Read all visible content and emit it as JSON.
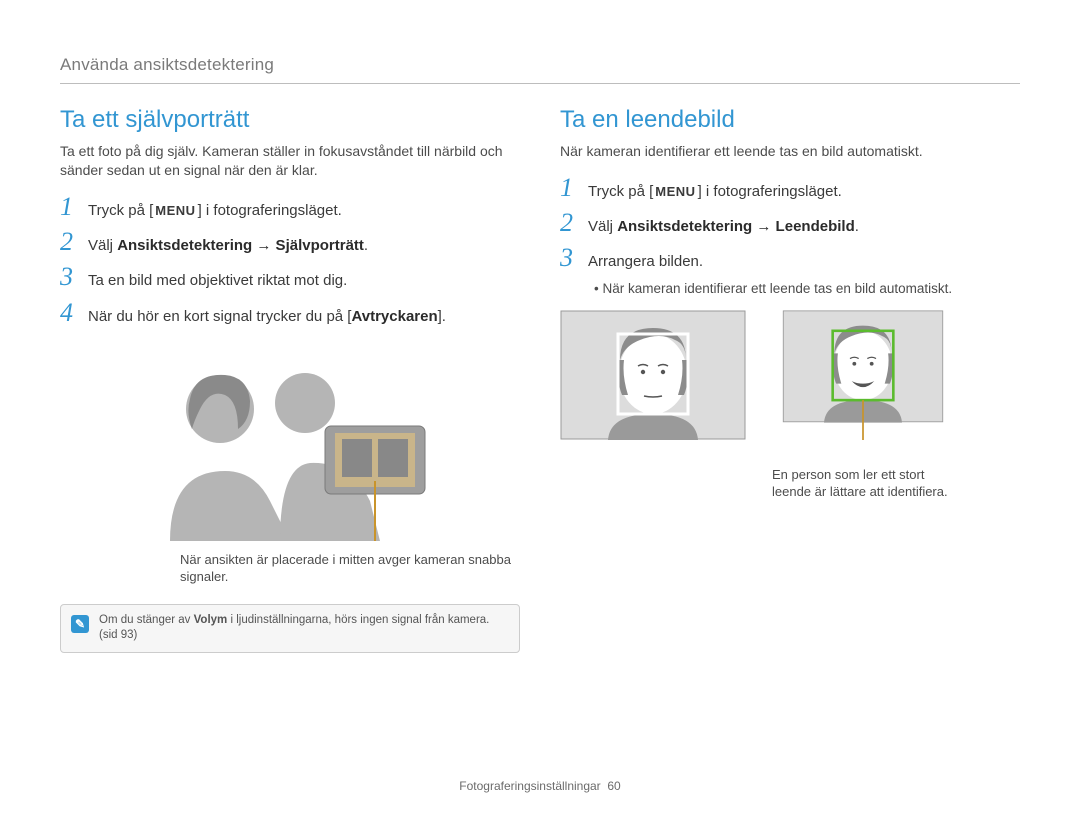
{
  "breadcrumb": "Använda ansiktsdetektering",
  "left": {
    "heading": "Ta ett självporträtt",
    "intro": "Ta ett foto på dig själv. Kameran ställer in fokusavståndet till närbild och sänder sedan ut en signal när den är klar.",
    "steps": [
      {
        "num": "1",
        "pre": "Tryck på [",
        "menu": "MENU",
        "post": "] i fotograferingsläget."
      },
      {
        "num": "2",
        "pre": "Välj ",
        "bold": "Ansiktsdetektering → Självporträtt",
        "post": "."
      },
      {
        "num": "3",
        "pre": "Ta en bild med objektivet riktat mot dig.",
        "post": ""
      },
      {
        "num": "4",
        "pre": "När du hör en kort signal trycker du på [",
        "bold": "Avtryckaren",
        "post": "]."
      }
    ],
    "caption": "När ansikten är placerade i mitten avger kameran snabba signaler.",
    "note_icon_name": "note-icon",
    "note_prefix": "Om du stänger av ",
    "note_bold": "Volym",
    "note_suffix": " i ljudinställningarna, hörs ingen signal från kamera. (sid 93)"
  },
  "right": {
    "heading": "Ta en leendebild",
    "intro": "När kameran identifierar ett leende tas en bild automatiskt.",
    "steps": [
      {
        "num": "1",
        "pre": "Tryck på [",
        "menu": "MENU",
        "post": "] i fotograferingsläget."
      },
      {
        "num": "2",
        "pre": "Välj ",
        "bold": "Ansiktsdetektering → Leendebild",
        "post": "."
      },
      {
        "num": "3",
        "pre": "Arrangera bilden.",
        "post": ""
      }
    ],
    "sub_bullet": "När kameran identifierar ett leende tas en bild automatiskt.",
    "smile_caption": "En person som ler ett stort leende är lättare att identifiera."
  },
  "footer_section": "Fotograferingsinställningar",
  "footer_page": "60"
}
